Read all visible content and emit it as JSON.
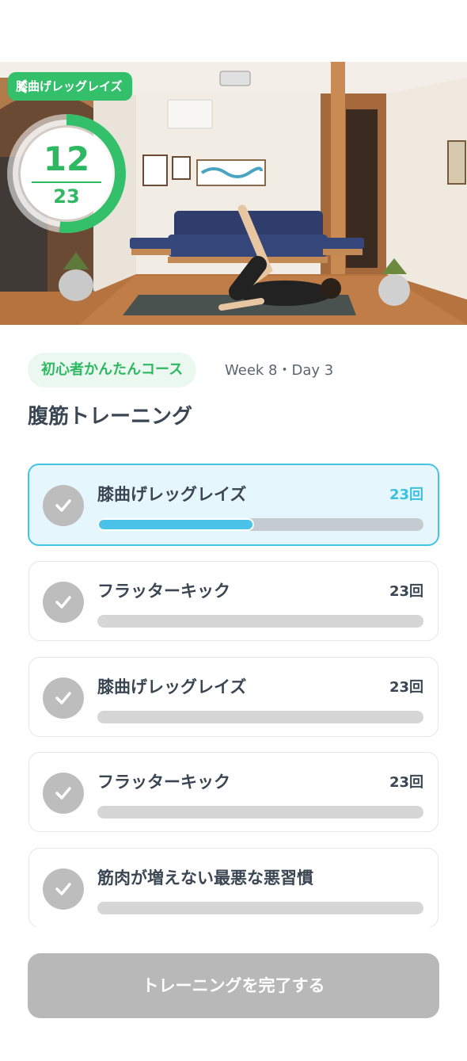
{
  "video": {
    "title": "膝曲げレッグレイズ",
    "count_current": "12",
    "count_total": "23",
    "progress": 0.52
  },
  "course": {
    "badge": "初心者かんたんコース",
    "schedule": "Week 8・Day 3",
    "title": "腹筋トレーニング"
  },
  "exercises": [
    {
      "name": "膝曲げレッグレイズ",
      "reps": "23回",
      "active": true,
      "progress": 0.48
    },
    {
      "name": "フラッターキック",
      "reps": "23回",
      "active": false,
      "progress": 0
    },
    {
      "name": "膝曲げレッグレイズ",
      "reps": "23回",
      "active": false,
      "progress": 0
    },
    {
      "name": "フラッターキック",
      "reps": "23回",
      "active": false,
      "progress": 0
    },
    {
      "name": "筋肉が増えない最悪な悪習慣",
      "reps": "",
      "active": false,
      "progress": 0
    }
  ],
  "complete_label": "トレーニングを完了する",
  "colors": {
    "accent_green": "#34c06a",
    "accent_blue": "#45c4e4",
    "disabled": "#b8b8b8"
  }
}
